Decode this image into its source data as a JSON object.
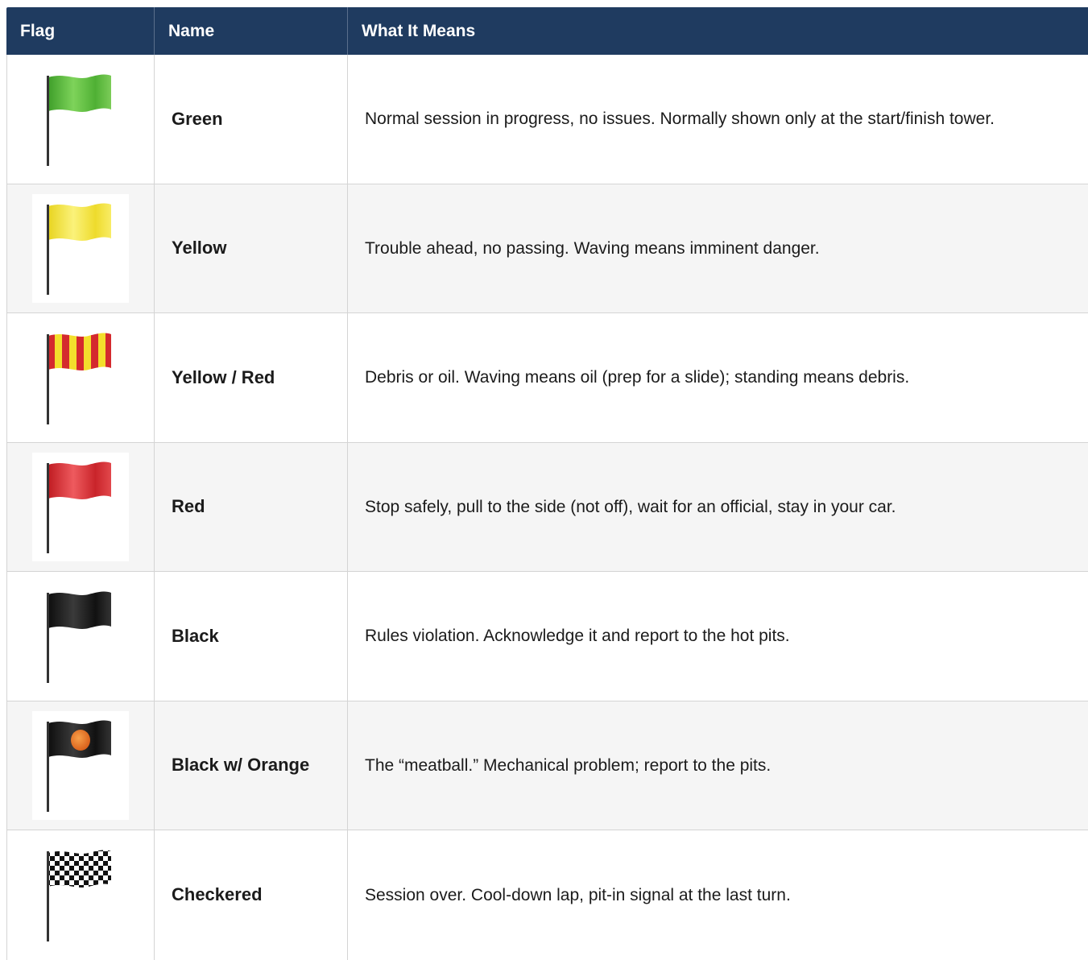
{
  "table": {
    "headers": [
      "Flag",
      "Name",
      "What It Means"
    ],
    "rows": [
      {
        "flag_icon": "green-flag-icon",
        "flag_color": "#5fbf3a",
        "name": "Green",
        "meaning": "Normal session in progress, no issues. Normally shown only at the start/finish tower."
      },
      {
        "flag_icon": "yellow-flag-icon",
        "flag_color": "#f3e63a",
        "name": "Yellow",
        "meaning": "Trouble ahead, no passing. Waving means imminent danger."
      },
      {
        "flag_icon": "yellow-red-striped-flag-icon",
        "flag_color": "#e8d62a",
        "name": "Yellow / Red",
        "meaning": "Debris or oil. Waving means oil (prep for a slide); standing means debris."
      },
      {
        "flag_icon": "red-flag-icon",
        "flag_color": "#d9282e",
        "name": "Red",
        "meaning": "Stop safely, pull to the side (not off), wait for an official, stay in your car."
      },
      {
        "flag_icon": "black-flag-icon",
        "flag_color": "#1a1a1a",
        "name": "Black",
        "meaning": "Rules violation. Acknowledge it and report to the hot pits."
      },
      {
        "flag_icon": "black-orange-meatball-flag-icon",
        "flag_color": "#1a1a1a",
        "name": "Black w/ Orange",
        "meaning": "The “meatball.” Mechanical problem; report to the pits."
      },
      {
        "flag_icon": "checkered-flag-icon",
        "flag_color": "#000000",
        "name": "Checkered",
        "meaning": "Session over. Cool-down lap, pit-in signal at the last turn."
      }
    ]
  },
  "colors": {
    "header_bg": "#1f3b60",
    "alt_row_bg": "#f5f5f5"
  }
}
